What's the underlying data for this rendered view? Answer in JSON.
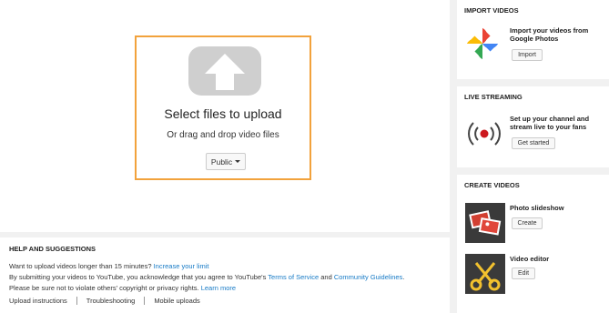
{
  "upload": {
    "title": "Select files to upload",
    "subtitle": "Or drag and drop video files",
    "privacy_value": "Public"
  },
  "help": {
    "title": "HELP AND SUGGESTIONS",
    "line1_text": "Want to upload videos longer than 15 minutes?",
    "line1_link": "Increase your limit",
    "line2_text": "By submitting your videos to YouTube, you acknowledge that you agree to YouTube's",
    "line2_link1": "Terms of Service",
    "line2_and": "and",
    "line2_link2": "Community Guidelines",
    "line3_text": "Please be sure not to violate others' copyright or privacy rights.",
    "line3_link": "Learn more",
    "links": [
      "Upload instructions",
      "Troubleshooting",
      "Mobile uploads"
    ]
  },
  "import": {
    "title": "IMPORT VIDEOS",
    "text": "Import your videos from Google Photos",
    "button": "Import"
  },
  "live": {
    "title": "LIVE STREAMING",
    "text": "Set up your channel and stream live to your fans",
    "button": "Get started"
  },
  "create": {
    "title": "CREATE VIDEOS",
    "slideshow_label": "Photo slideshow",
    "slideshow_button": "Create",
    "editor_label": "Video editor",
    "editor_button": "Edit"
  },
  "icons": {
    "upload": "upload-arrow-icon",
    "photos": "google-photos-pinwheel-icon",
    "live": "live-broadcast-icon",
    "slideshow": "photo-slideshow-icon",
    "editor": "scissors-icon"
  },
  "colors": {
    "accent_border": "#f2a23c",
    "link": "#167ac6",
    "live_red": "#cc181e"
  }
}
